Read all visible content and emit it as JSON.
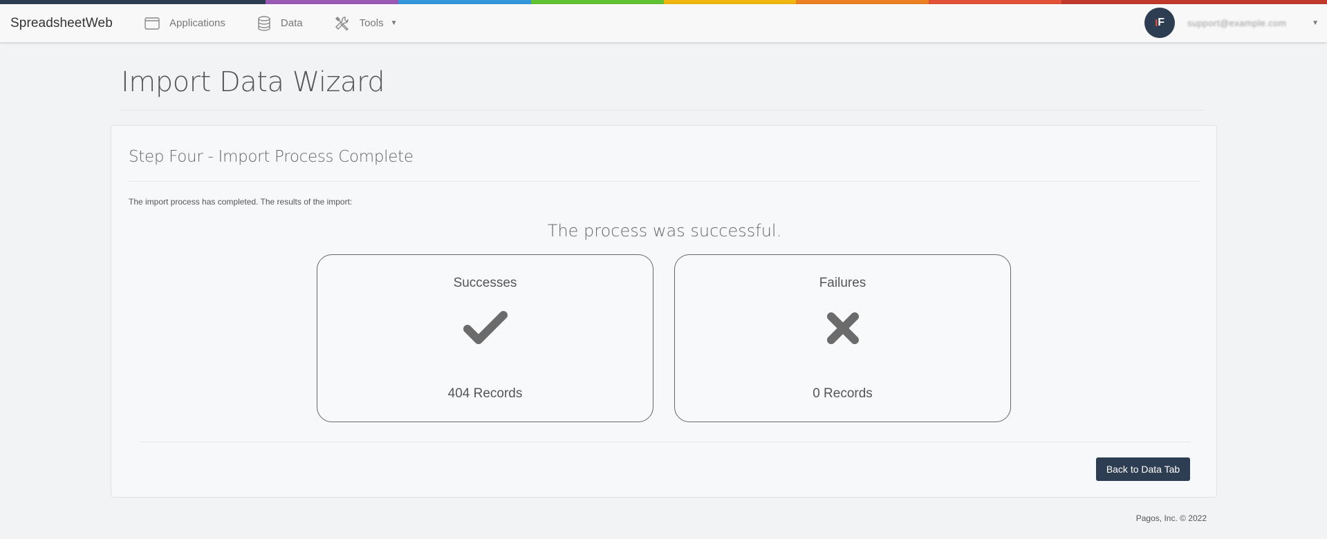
{
  "topbar": {
    "stripe_colors": [
      "#2e3e52",
      "#9b59b6",
      "#3498db",
      "#62c232",
      "#f1b60f",
      "#ec8123",
      "#e25236",
      "#c0392b"
    ]
  },
  "nav": {
    "brand": "SpreadsheetWeb",
    "items": [
      {
        "label": "Applications",
        "icon": "window-icon"
      },
      {
        "label": "Data",
        "icon": "database-icon"
      },
      {
        "label": "Tools",
        "icon": "tools-icon",
        "has_dropdown": true
      }
    ],
    "user": {
      "avatar_text": "F",
      "avatar_accent": "I",
      "email": "support@example.com"
    }
  },
  "page": {
    "title": "Import Data Wizard"
  },
  "step": {
    "title": "Step Four - Import Process Complete",
    "intro": "The import process has completed. The results of the import:",
    "status_message": "The process was successful.",
    "successes": {
      "label": "Successes",
      "count": "404 Records",
      "icon": "check-icon"
    },
    "failures": {
      "label": "Failures",
      "count": "0 Records",
      "icon": "x-icon"
    },
    "back_button": "Back to Data Tab"
  },
  "footer": {
    "text": "Pagos, Inc. © 2022"
  },
  "colors": {
    "accent_dark": "#2e3e52",
    "background": "#f2f3f5",
    "icon_gray": "#6b6b6b"
  }
}
